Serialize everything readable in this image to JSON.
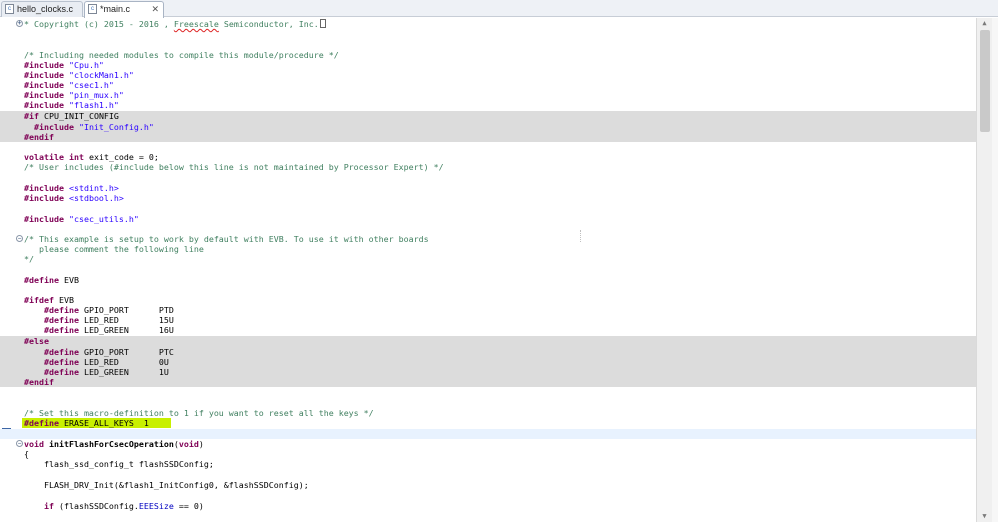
{
  "tabs": [
    {
      "label": "hello_clocks.c",
      "active": false
    },
    {
      "label": "*main.c",
      "active": true
    }
  ],
  "tab_close_glyph": "✕",
  "file_icon_letter": "c",
  "code": {
    "l0": "* Copyright (c) 2015 - 2016 , ",
    "l0b": "Freescale",
    "l0c": " Semiconductor, Inc.",
    "l3": "/* Including needed modules to compile this module/procedure */",
    "l4": [
      "#include",
      " \"Cpu.h\""
    ],
    "l5": [
      "#include",
      " \"clockMan1.h\""
    ],
    "l6": [
      "#include",
      " \"csec1.h\""
    ],
    "l7": [
      "#include",
      " \"pin_mux.h\""
    ],
    "l8": [
      "#include",
      " \"flash1.h\""
    ],
    "l9": [
      "#if",
      " CPU_INIT_CONFIG"
    ],
    "l10": [
      "  #include",
      " \"Init_Config.h\""
    ],
    "l11": "#endif",
    "l13": [
      "volatile",
      " ",
      "int",
      " exit_code = 0;"
    ],
    "l14": "/* User includes (#include below this line is not maintained by Processor Expert) */",
    "l16": [
      "#include",
      " <stdint.h>"
    ],
    "l17": [
      "#include",
      " <stdbool.h>"
    ],
    "l19": [
      "#include",
      " \"csec_utils.h\""
    ],
    "l21": "/* This example is setup to work by default with EVB. To use it with other boards",
    "l22": "   please comment the following line",
    "l23": "*/",
    "l25": [
      "#define",
      " EVB"
    ],
    "l27": [
      "#ifdef",
      " EVB"
    ],
    "l28": [
      "    #define",
      " GPIO_PORT      PTD"
    ],
    "l29": [
      "    #define",
      " LED_RED        15U"
    ],
    "l30": [
      "    #define",
      " LED_GREEN      16U"
    ],
    "l31": "#else",
    "l32": [
      "    #define",
      " GPIO_PORT      PTC"
    ],
    "l33": [
      "    #define",
      " LED_RED        0U"
    ],
    "l34": [
      "    #define",
      " LED_GREEN      1U"
    ],
    "l35": "#endif",
    "l38": "/* Set this macro-definition to 1 if you want to reset all the keys */",
    "l39": [
      "#define",
      " ERASE_ALL_KEYS  1"
    ],
    "l41": [
      "void",
      " ",
      "initFlashForCsecOperation",
      "(",
      "void",
      ")"
    ],
    "l42": "{",
    "l43": "    flash_ssd_config_t flashSSDConfig;",
    "l45": "    FLASH_DRV_Init(&flash1_InitConfig0, &flashSSDConfig);",
    "l47": [
      "    ",
      "if",
      " (flashSSDConfig.",
      "EEESize",
      " == 0)"
    ]
  }
}
